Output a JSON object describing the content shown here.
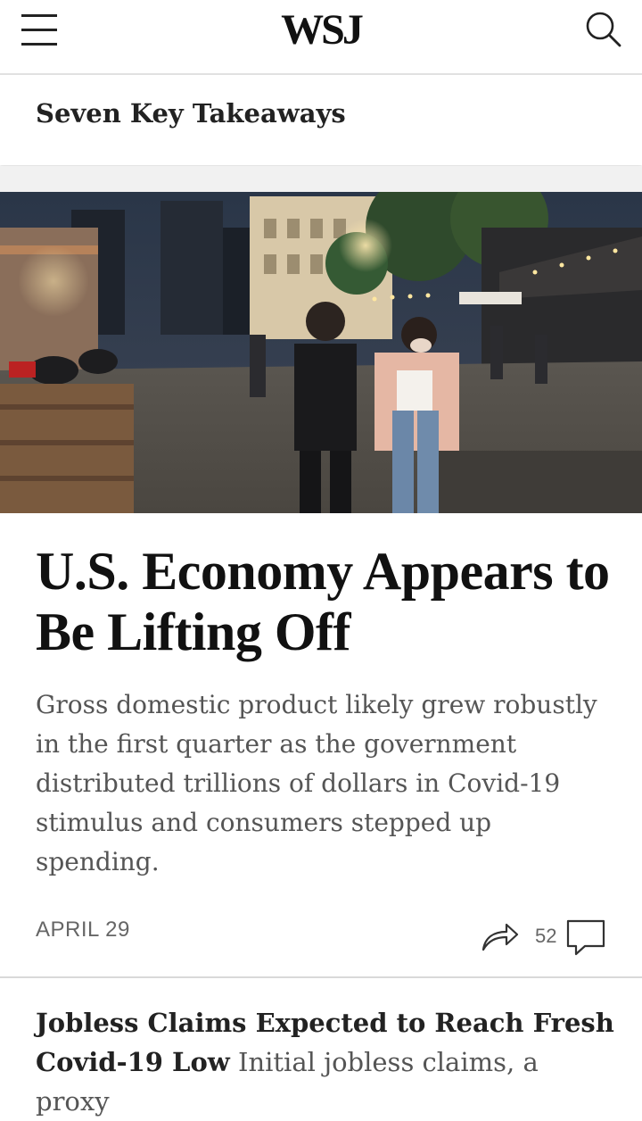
{
  "header": {
    "logo": "WSJ",
    "menu_icon": "hamburger-menu-icon",
    "search_icon": "search-icon"
  },
  "section": {
    "title": "Seven Key Takeaways"
  },
  "article": {
    "headline": "U.S. Economy Appears to Be Lifting Off",
    "summary": "Gross domestic product likely grew robustly in the first quarter as the government distributed trillions of dollars in Covid-19 stimulus and consumers stepped up spending.",
    "date": "APRIL 29",
    "comments": "52",
    "share_icon": "share-arrow-icon",
    "comment_icon": "comment-bubble-icon"
  },
  "next_article": {
    "title": "Jobless Claims Expected to Reach Fresh Covid-19 Low",
    "summary": "Initial jobless claims, a proxy"
  }
}
